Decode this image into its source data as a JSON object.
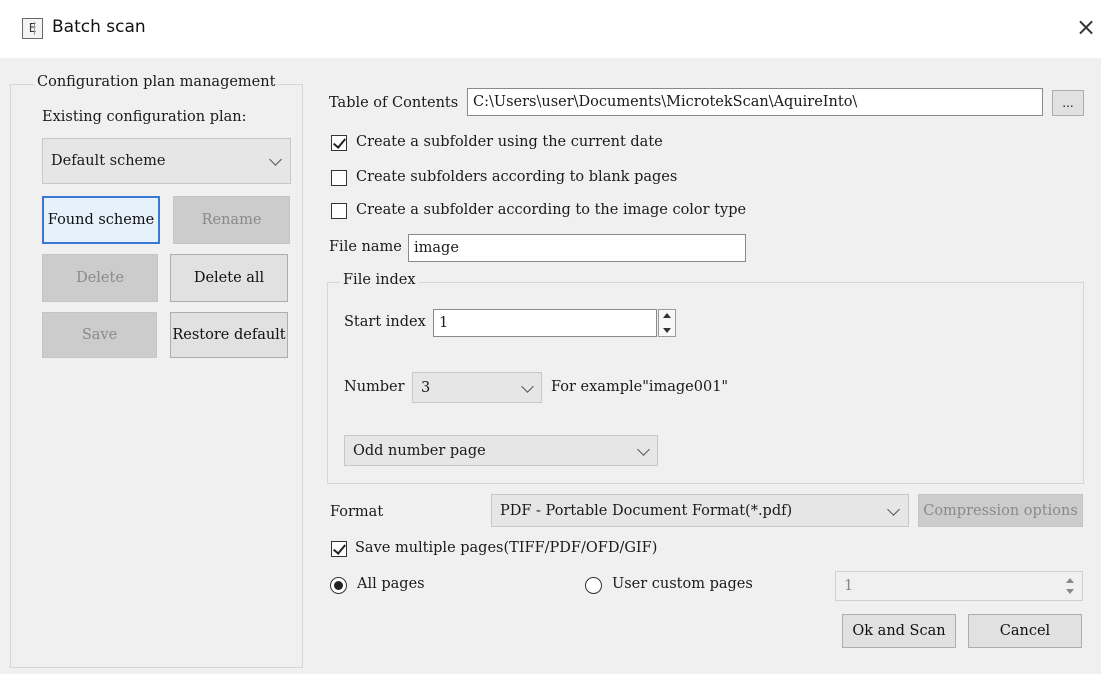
{
  "window": {
    "title": "Batch scan",
    "icon_glyph": "E",
    "close_glyph": "×"
  },
  "plan": {
    "group_title": "Configuration plan management",
    "existing_label": "Existing configuration plan:",
    "selected_scheme": "Default scheme",
    "buttons": {
      "found": "Found scheme",
      "rename": "Rename",
      "delete": "Delete",
      "delete_all": "Delete all",
      "save": "Save",
      "restore": "Restore default"
    }
  },
  "settings": {
    "toc_label": "Table of Contents",
    "toc_value": "C:\\Users\\user\\Documents\\MicrotekScan\\AquireInto\\",
    "browse_label": "...",
    "chk_date": {
      "label": "Create a subfolder using the current date",
      "checked": true
    },
    "chk_blank": {
      "label": "Create subfolders according to blank pages",
      "checked": false
    },
    "chk_color": {
      "label": "Create a subfolder according to the image color type",
      "checked": false
    },
    "file_name_label": "File name",
    "file_name_value": "image",
    "file_index": {
      "group_title": "File index",
      "start_label": "Start index",
      "start_value": "1",
      "number_label": "Number",
      "number_value": "3",
      "example_text": "For example\"image001\"",
      "page_mode": "Odd number page"
    },
    "format_label": "Format",
    "format_value": "PDF - Portable Document Format(*.pdf)",
    "compression_label": "Compression options",
    "chk_multi": {
      "label": "Save multiple pages(TIFF/PDF/OFD/GIF)",
      "checked": true
    },
    "radio_all": {
      "label": "All pages",
      "selected": true
    },
    "radio_custom": {
      "label": "User custom pages",
      "selected": false
    },
    "custom_value": "1"
  },
  "actions": {
    "ok_scan": "Ok and Scan",
    "cancel": "Cancel"
  },
  "icons": [
    "app-icon",
    "close-icon",
    "chevron-down-icon",
    "spinner-icon",
    "checkbox-checked",
    "radio-selected"
  ]
}
